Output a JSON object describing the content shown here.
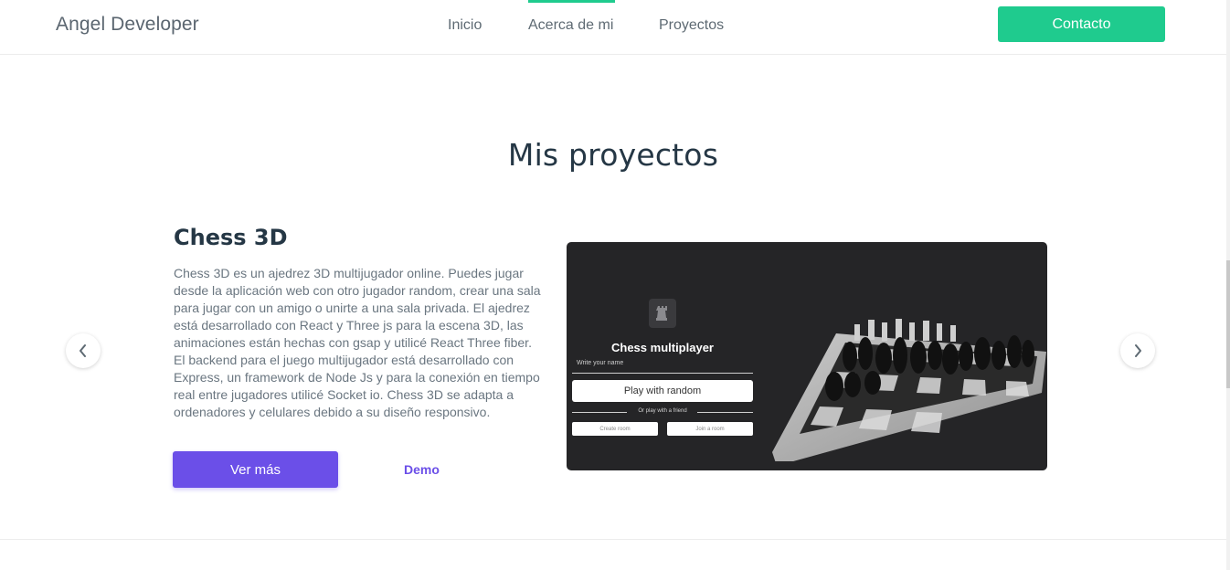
{
  "nav": {
    "brand": "Angel Developer",
    "links": [
      {
        "label": "Inicio"
      },
      {
        "label": "Acerca de mi",
        "active": true
      },
      {
        "label": "Proyectos"
      }
    ],
    "contact_label": "Contacto"
  },
  "section": {
    "title": "Mis proyectos"
  },
  "carousel": {
    "prev_icon": "chevron-left-icon",
    "next_icon": "chevron-right-icon"
  },
  "project": {
    "title": "Chess 3D",
    "description": "Chess 3D es un ajedrez 3D multijugador online. Puedes jugar desde la aplicación web con otro jugador random, crear una sala para jugar con un amigo o unirte a una sala privada. El ajedrez está desarrollado con React y Three js para la escena 3D, las animaciones están hechas con gsap y utilicé React Three fiber. El backend para el juego multijugador está desarrollado con Express, un framework de Node Js y para la conexión en tiempo real entre jugadores utilicé Socket io. Chess 3D se adapta a ordenadores y celulares debido a su diseño responsivo.",
    "more_label": "Ver más",
    "demo_label": "Demo",
    "preview": {
      "heading": "Chess multiplayer",
      "name_label": "Write your name",
      "play_random": "Play with random",
      "or_friend": "Or play with a friend",
      "create_room": "Create room",
      "join_room": "Join a room",
      "logo_icon": "chess-rook-icon"
    }
  },
  "colors": {
    "accent_green": "#1fcb8e",
    "accent_purple": "#6b4fe8",
    "preview_bg": "#252527"
  }
}
